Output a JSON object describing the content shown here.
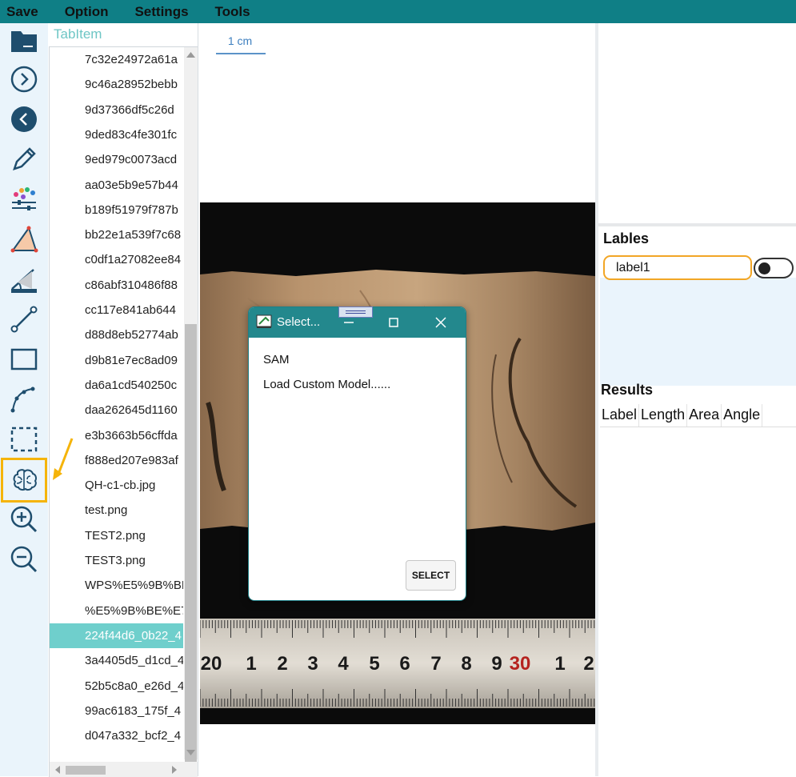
{
  "menu": [
    "Save",
    "Option",
    "Settings",
    "Tools"
  ],
  "tools": [
    {
      "icon": "folder-icon"
    },
    {
      "icon": "next-icon"
    },
    {
      "icon": "previous-icon"
    },
    {
      "icon": "pencil-icon"
    },
    {
      "icon": "color-adjust-icon"
    },
    {
      "icon": "polygon-icon"
    },
    {
      "icon": "angle-measure-icon"
    },
    {
      "icon": "line-icon"
    },
    {
      "icon": "rectangle-icon"
    },
    {
      "icon": "polyline-icon"
    },
    {
      "icon": "dashed-rectangle-icon"
    },
    {
      "icon": "brain-icon",
      "active": true
    },
    {
      "icon": "zoom-in-icon"
    },
    {
      "icon": "zoom-out-icon"
    }
  ],
  "file_panel": {
    "tab": "TabItem",
    "files": [
      "7c32e24972a61a",
      "9c46a28952bebb",
      "9d37366df5c26d",
      "9ded83c4fe301fc",
      "9ed979c0073acd",
      "aa03e5b9e57b44",
      "b189f51979f787b",
      "bb22e1a539f7c68",
      "c0df1a27082ee84",
      "c86abf310486f88",
      "cc117e841ab644",
      "d88d8eb52774ab",
      "d9b81e7ec8ad09",
      "da6a1cd540250c",
      "daa262645d1160",
      "e3b3663b56cffda",
      "f888ed207e983af",
      "QH-c1-cb.jpg",
      "test.png",
      "TEST2.png",
      "TEST3.png",
      "WPS%E5%9B%BE",
      "%E5%9B%BE%E7",
      "224f44d6_0b22_4",
      "3a4405d5_d1cd_4",
      "52b5c8a0_e26d_4",
      "99ac6183_175f_4",
      "d047a332_bcf2_4"
    ],
    "selected_index": 23
  },
  "canvas": {
    "scale_label": "1 cm"
  },
  "ruler": {
    "numbers": [
      "20",
      "1",
      "2",
      "3",
      "4",
      "5",
      "6",
      "7",
      "8",
      "9",
      "30",
      "1",
      "2"
    ]
  },
  "labels_panel": {
    "title": "Lables",
    "label_value": "label1"
  },
  "results_panel": {
    "title": "Results",
    "columns": [
      "Label",
      "Length",
      "Area",
      "Angle"
    ]
  },
  "dialog": {
    "title": "Select...",
    "items": [
      "SAM",
      "Load Custom Model......"
    ],
    "button": "SELECT"
  },
  "colors": {
    "accent": "#0f7f86",
    "dialog_title": "#23888d",
    "highlight": "#f5b40a",
    "selected_row": "#6fcfcc"
  }
}
